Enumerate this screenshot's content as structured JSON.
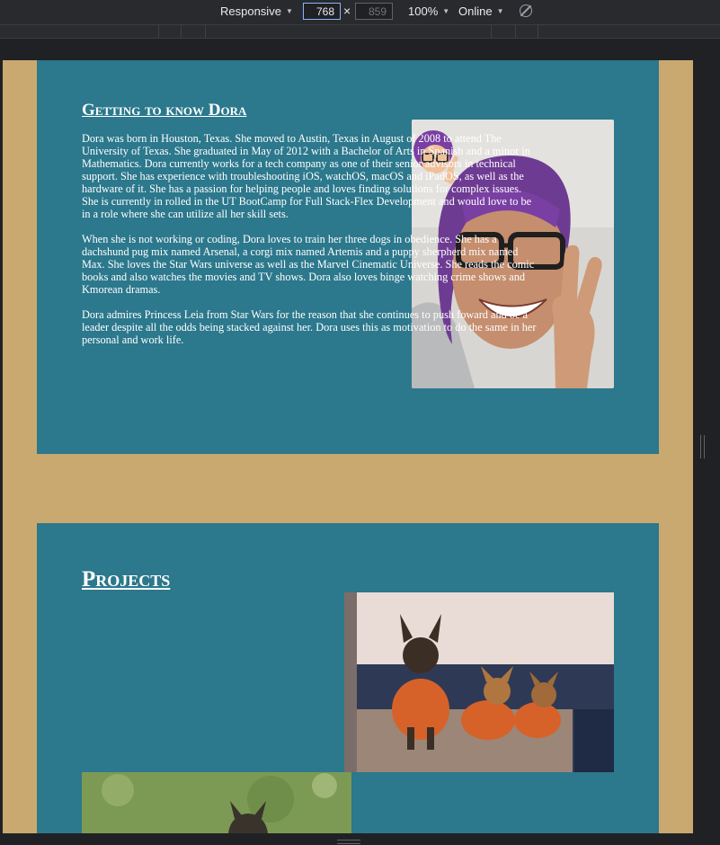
{
  "toolbar": {
    "device": "Responsive",
    "width_value": "768",
    "height_placeholder": "859",
    "times": "×",
    "zoom": "100%",
    "throttle": "Online"
  },
  "about": {
    "title": "Getting to know Dora",
    "paragraphs": [
      "Dora was born in Houston, Texas. She moved to Austin, Texas in August of 2008 to attend The University of Texas. She graduated in May of 2012 with a Bachelor of Arts in Spanish and a minor in Mathematics. Dora currently works for a tech company as one of their senior advisors in technical support. She has experience with troubleshooting iOS, watchOS, macOS and iPadOS, as well as the hardware of it. She has a passion for helping people and loves finding solutions for complex issues. She is currently in rolled in the UT BootCamp for Full Stack-Flex Development and would love to be in a role where she can utilize all her skill sets.",
      "When she is not working or coding, Dora loves to train her three dogs in obedience. She has a dachshund pug mix named Arsenal, a corgi mix named Artemis and a puppy sherpherd mix named Max. She loves the Star Wars universe as well as the Marvel Cinematic Universe. She reads the comic books and also watches the movies and TV shows. Dora also loves binge watching crime shows and Kmorean dramas.",
      "Dora admires Princess Leia from Star Wars for the reason that she continues to push foward and be a leader despite all the odds being stacked against her. Dora uses this as motivation to do the same in her personal and work life."
    ]
  },
  "projects": {
    "title": "Projects"
  },
  "colors": {
    "page_bg": "#c9a96f",
    "card_bg": "#2c788c",
    "text": "#ffffff",
    "devtools_bg": "#292a2d"
  }
}
